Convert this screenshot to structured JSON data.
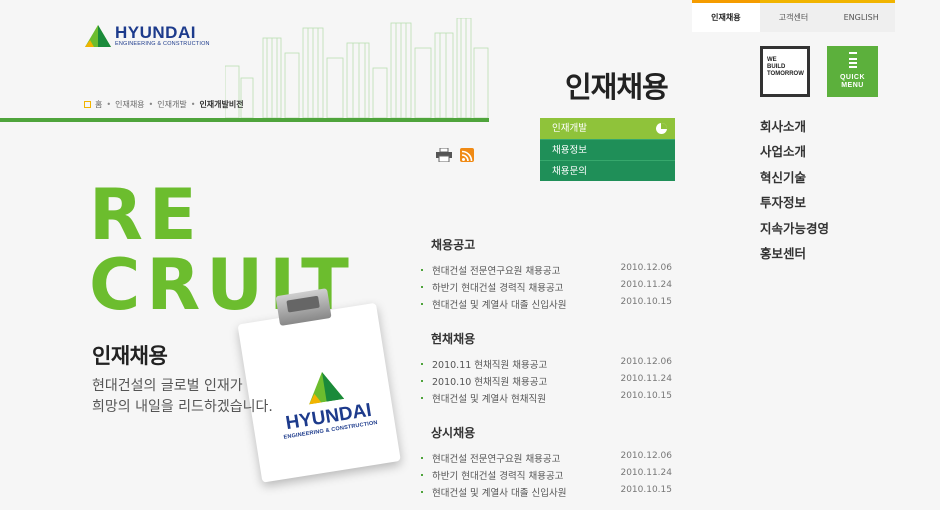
{
  "brand": {
    "name": "HYUNDAI",
    "sub": "ENGINEERING & CONSTRUCTION",
    "colors": {
      "green": "#6cbd2e",
      "navy": "#1d3b8c",
      "yellow": "#f1b400"
    }
  },
  "breadcrumb": {
    "home": "홈",
    "items": [
      "인재채용",
      "인재개발"
    ],
    "current": "인재개발비전"
  },
  "top_tabs": [
    "인재채용",
    "고객센터",
    "ENGLISH"
  ],
  "we_build": [
    "WE",
    "BUILD",
    "TOMORROW"
  ],
  "quick_menu": [
    "QUICK",
    "MENU"
  ],
  "section_title": "인재채용",
  "submenu": [
    {
      "label": "인재개발"
    },
    {
      "label": "채용정보"
    },
    {
      "label": "채용문의"
    }
  ],
  "gnb": [
    "회사소개",
    "사업소개",
    "혁신기술",
    "투자정보",
    "지속가능경영",
    "홍보센터"
  ],
  "hero": {
    "line1": "RE",
    "line2": "CRUIT",
    "heading": "인재채용",
    "desc1": "현대건설의 글로벌 인재가",
    "desc2": "희망의 내일을 리드하겠습니다."
  },
  "card": {
    "name": "HYUNDAI",
    "sub": "ENGINEERING & CONSTRUCTION"
  },
  "news": [
    {
      "title": "채용공고",
      "items": [
        {
          "text": "현대건설 전문연구요원 채용공고",
          "date": "2010.12.06"
        },
        {
          "text": "하반기 현대건설 경력직 채용공고",
          "date": "2010.11.24"
        },
        {
          "text": "현대건설 및 계열사 대졸 신입사원",
          "date": "2010.10.15"
        }
      ]
    },
    {
      "title": "현채채용",
      "items": [
        {
          "text": "2010.11 현채직원 채용공고",
          "date": "2010.12.06"
        },
        {
          "text": "2010.10 현채직원 채용공고",
          "date": "2010.11.24"
        },
        {
          "text": "현대건설 및 계열사 현채직원",
          "date": "2010.10.15"
        }
      ]
    },
    {
      "title": "상시채용",
      "items": [
        {
          "text": "현대건설 전문연구요원 채용공고",
          "date": "2010.12.06"
        },
        {
          "text": "하반기 현대건설 경력직 채용공고",
          "date": "2010.11.24"
        },
        {
          "text": "현대건설 및 계열사 대졸 신입사원",
          "date": "2010.10.15"
        }
      ]
    }
  ]
}
